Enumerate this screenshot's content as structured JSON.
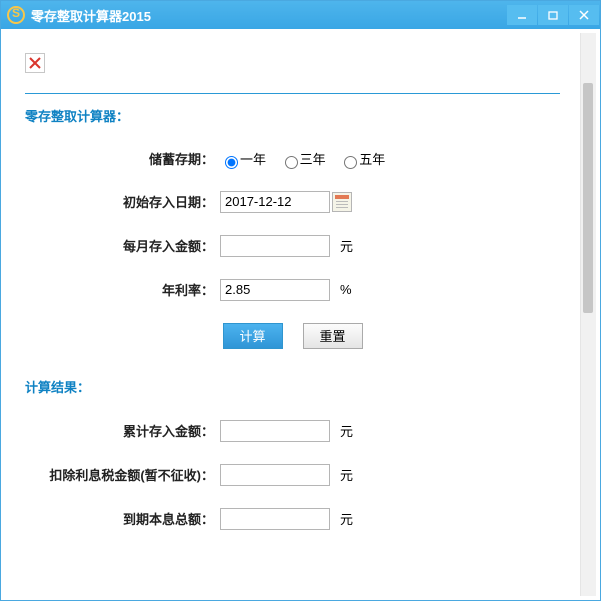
{
  "window": {
    "title": "零存整取计算器2015"
  },
  "form": {
    "section_title": "零存整取计算器：",
    "deposit_term": {
      "label": "储蓄存期：",
      "options": [
        "一年",
        "三年",
        "五年"
      ],
      "selected": "一年"
    },
    "start_date": {
      "label": "初始存入日期：",
      "value": "2017-12-12"
    },
    "monthly_amount": {
      "label": "每月存入金额：",
      "value": "",
      "unit": "元"
    },
    "annual_rate": {
      "label": "年利率：",
      "value": "2.85",
      "unit": "%"
    },
    "buttons": {
      "calc": "计算",
      "reset": "重置"
    }
  },
  "result": {
    "section_title": "计算结果：",
    "total_deposit": {
      "label": "累计存入金额：",
      "value": "",
      "unit": "元"
    },
    "interest_tax": {
      "label": "扣除利息税金额(暂不征收)：",
      "value": "",
      "unit": "元"
    },
    "maturity": {
      "label": "到期本息总额：",
      "value": "",
      "unit": "元"
    }
  }
}
